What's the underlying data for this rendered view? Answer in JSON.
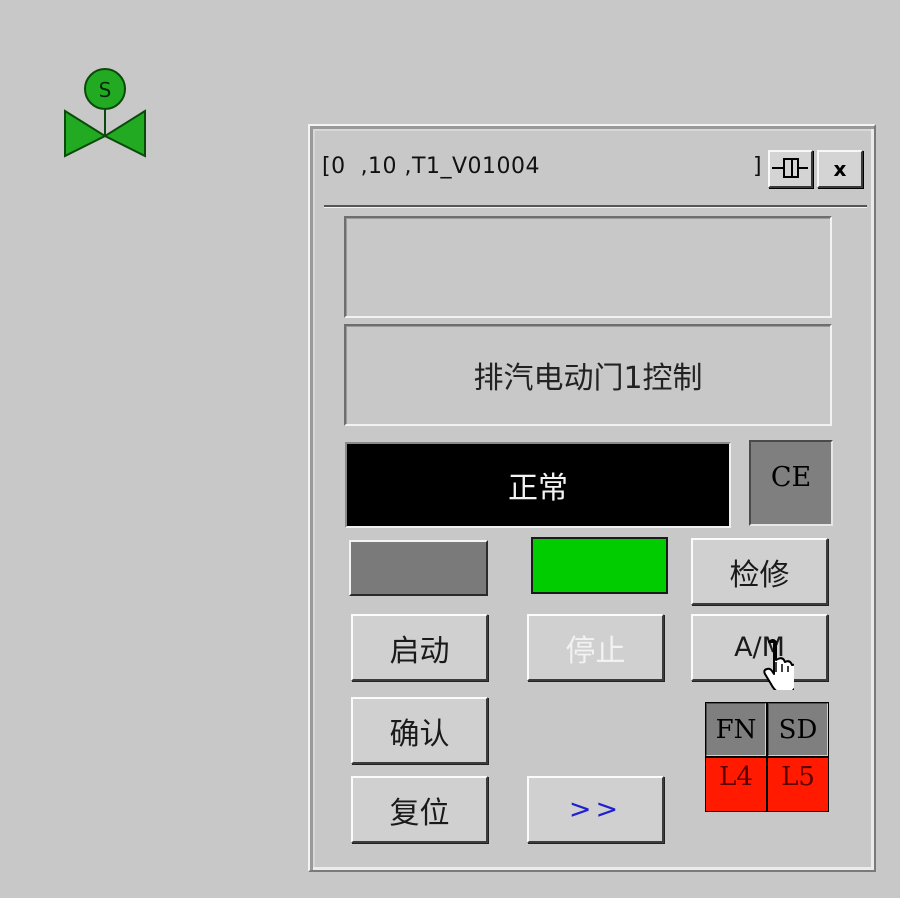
{
  "valve_symbol": {
    "label": "S",
    "color": "#22aa22"
  },
  "window": {
    "title": "[0  ,10 ,T1_V01004",
    "title_close_bracket": "]",
    "close_label": "x"
  },
  "panel": {
    "description": "排汽电动门1控制",
    "status": "正常",
    "ce_label": "CE",
    "indicators": {
      "left_color": "#7a7a7a",
      "right_color": "#00cc00"
    },
    "buttons": {
      "repair": "检修",
      "start": "启动",
      "stop": "停止",
      "am": "A/M",
      "confirm": "确认",
      "reset": "复位",
      "more": ">>"
    },
    "tags": [
      {
        "label": "FN",
        "color": "#7f7f7f"
      },
      {
        "label": "SD",
        "color": "#7f7f7f"
      },
      {
        "label": "L4",
        "color": "#ff1a00"
      },
      {
        "label": "L5",
        "color": "#ff1a00"
      }
    ]
  }
}
